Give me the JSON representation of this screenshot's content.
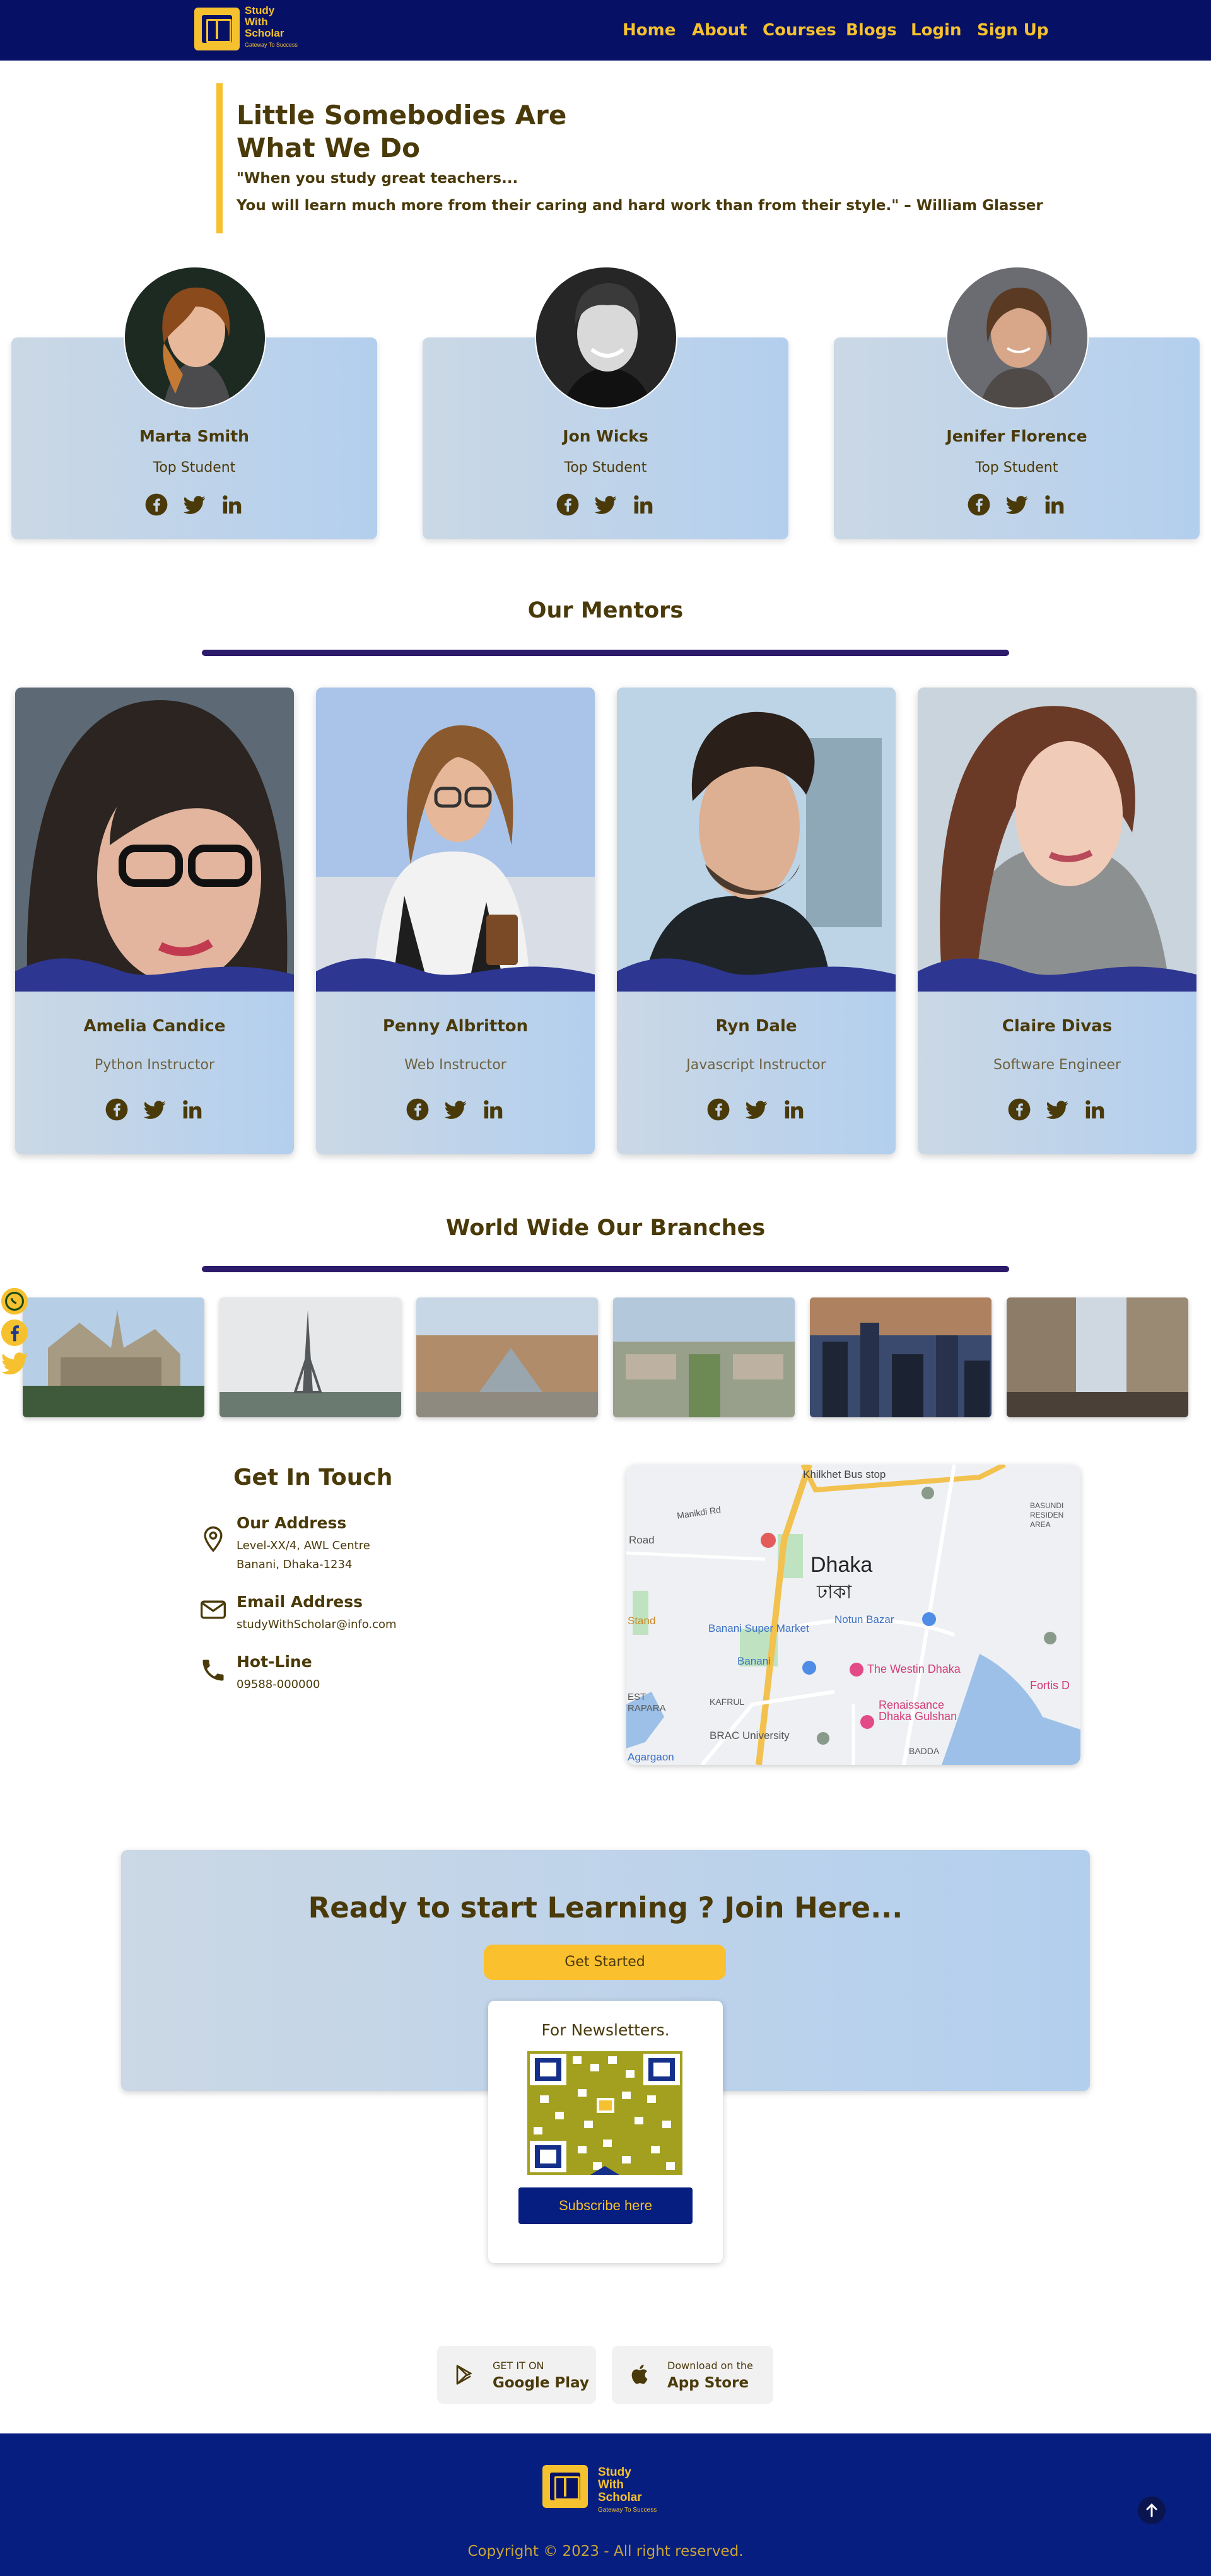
{
  "brand": {
    "line1": "Study",
    "line2": "With",
    "line3": "Scholar",
    "tagline": "Gateway To Success"
  },
  "nav": {
    "items": [
      "Home",
      "About",
      "Courses",
      "Blogs",
      "Login",
      "Sign Up"
    ]
  },
  "intro": {
    "title_line1": "Little Somebodies Are",
    "title_line2": "What We Do",
    "quote_line1": "\"When you study great teachers...",
    "quote_line2": "You will learn much more from their caring and hard work than from their style.\" – William Glasser"
  },
  "students": [
    {
      "name": "Marta Smith",
      "role": "Top Student"
    },
    {
      "name": "Jon Wicks",
      "role": "Top Student"
    },
    {
      "name": "Jenifer Florence",
      "role": "Top Student"
    }
  ],
  "mentors_section": {
    "title": "Our Mentors"
  },
  "mentors": [
    {
      "name": "Amelia Candice",
      "role": "Python Instructor"
    },
    {
      "name": "Penny Albritton",
      "role": "Web Instructor"
    },
    {
      "name": "Ryn Dale",
      "role": "Javascript Instructor"
    },
    {
      "name": "Claire Divas",
      "role": "Software Engineer"
    }
  ],
  "branches_section": {
    "title": "World Wide Our Branches"
  },
  "contact": {
    "title": "Get In Touch",
    "address_title": "Our Address",
    "address_line1": "Level-XX/4, AWL Centre",
    "address_line2": "Banani, Dhaka-1234",
    "email_title": "Email Address",
    "email": "studyWithScholar@info.com",
    "hotline_title": "Hot-Line",
    "phone": "09588-000000"
  },
  "map": {
    "labels": [
      "Khilkhet Bus stop",
      "Dhaka",
      "ঢাকা",
      "Notun Bazar",
      "Banani Super Market",
      "The Westin Dhaka",
      "Renaissance Dhaka Gulshan",
      "BRAC University",
      "Fortis D",
      "BASUNDI RESIDEN AREA",
      "KAFRUL",
      "EST RAPARA",
      "Road",
      "Stand",
      "Agargaon",
      "BADDA",
      "Banani",
      "Manikdi Rd"
    ]
  },
  "cta": {
    "title": "Ready to start Learning ? Join Here...",
    "button": "Get Started",
    "newsletter_title": "For Newsletters.",
    "subscribe": "Subscribe here"
  },
  "stores": [
    {
      "small": "GET IT ON",
      "big": "Google Play",
      "icon": "google-play-icon"
    },
    {
      "small": "Download on the",
      "big": "App Store",
      "icon": "apple-icon"
    }
  ],
  "footer": {
    "copyright": "Copyright © 2023 - All right reserved."
  },
  "colors": {
    "navy": "#061166",
    "gold": "#f6c12e",
    "heading": "#4a3a0a",
    "card": "#b3cfee",
    "purple": "#2c1a6b"
  }
}
